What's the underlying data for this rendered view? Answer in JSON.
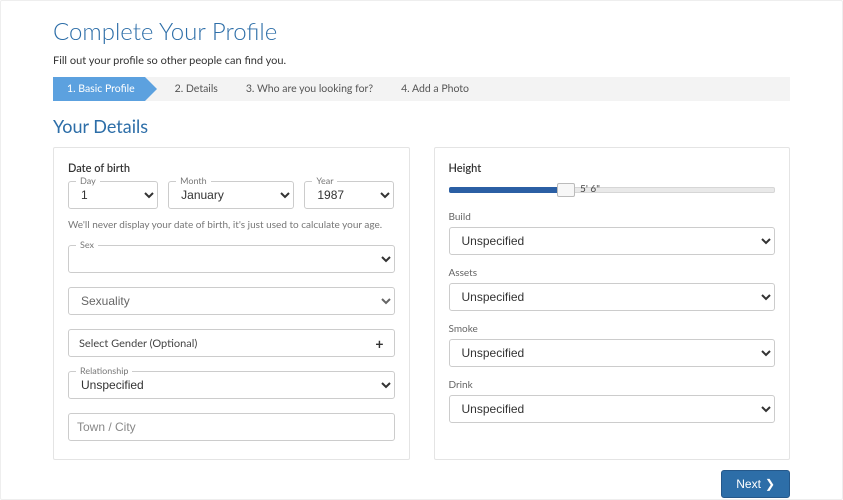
{
  "header": {
    "title": "Complete Your Profile",
    "subtitle": "Fill out your profile so other people can find you."
  },
  "wizard": {
    "steps": [
      "1. Basic Profile",
      "2. Details",
      "3. Who are you looking for?",
      "4. Add a Photo"
    ],
    "active_index": 0
  },
  "section_title": "Your Details",
  "left": {
    "dob_label": "Date of birth",
    "day_label": "Day",
    "month_label": "Month",
    "year_label": "Year",
    "day_value": "1",
    "month_value": "January",
    "year_value": "1987",
    "dob_note": "We'll never display your date of birth, it's just used to calculate your age.",
    "sex_label": "Sex",
    "sex_value": "",
    "sexuality_placeholder": "Sexuality",
    "sexuality_value": "",
    "gender_label": "Select Gender (Optional)",
    "relationship_label": "Relationship",
    "relationship_value": "Unspecified",
    "town_placeholder": "Town / City",
    "town_value": ""
  },
  "right": {
    "height_label": "Height",
    "height_value": "5' 6\"",
    "height_percent": 36,
    "build_label": "Build",
    "build_value": "Unspecified",
    "assets_label": "Assets",
    "assets_value": "Unspecified",
    "smoke_label": "Smoke",
    "smoke_value": "Unspecified",
    "drink_label": "Drink",
    "drink_value": "Unspecified"
  },
  "footer": {
    "next_label": "Next"
  }
}
